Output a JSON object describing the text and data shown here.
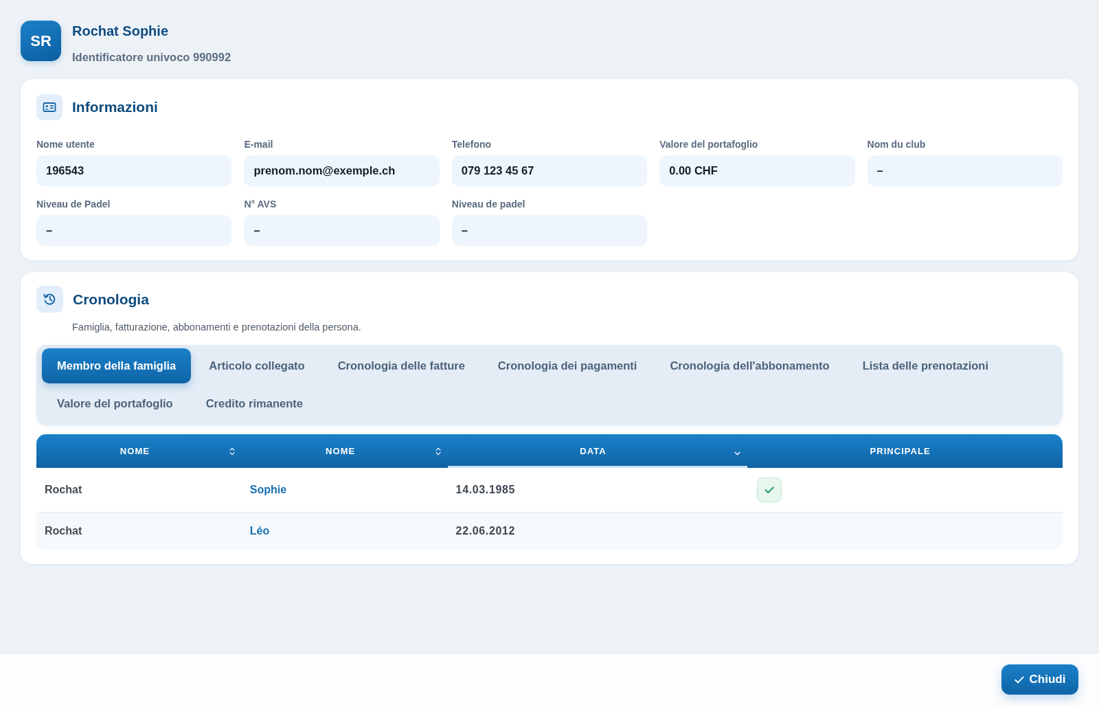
{
  "profile": {
    "initials": "SR",
    "name": "Rochat Sophie",
    "identifier": "Identificatore univoco 990992"
  },
  "info_card": {
    "title": "Informazioni",
    "fields": [
      {
        "label": "Nome utente",
        "value": "196543"
      },
      {
        "label": "E-mail",
        "value": "prenom.nom@exemple.ch"
      },
      {
        "label": "Telefono",
        "value": "079 123 45 67"
      },
      {
        "label": "Valore del portafoglio",
        "value": "0.00 CHF"
      },
      {
        "label": "Nom du club",
        "value": "–"
      },
      {
        "label": "Niveau de Padel",
        "value": "–"
      },
      {
        "label": "N° AVS",
        "value": "–"
      },
      {
        "label": "Niveau de padel",
        "value": "–"
      }
    ]
  },
  "history_card": {
    "title": "Cronologia",
    "subtitle": "Famiglia, fatturazione, abbonamenti e prenotazioni della persona.",
    "tabs": [
      {
        "label": "Membro della famiglia",
        "selected": true
      },
      {
        "label": "Articolo collegato",
        "selected": false
      },
      {
        "label": "Cronologia delle fatture",
        "selected": false
      },
      {
        "label": "Cronologia dei pagamenti",
        "selected": false
      },
      {
        "label": "Cronologia dell'abbonamento",
        "selected": false
      },
      {
        "label": "Lista delle prenotazioni",
        "selected": false
      },
      {
        "label": "Valore del portafoglio",
        "selected": false
      },
      {
        "label": "Credito rimanente",
        "selected": false
      }
    ],
    "table": {
      "columns": [
        {
          "label": "NOME",
          "sortable": true,
          "sorted": false
        },
        {
          "label": "NOME",
          "sortable": true,
          "sorted": false
        },
        {
          "label": "DATA",
          "sortable": true,
          "sorted": true
        },
        {
          "label": "PRINCIPALE",
          "sortable": false,
          "sorted": false
        }
      ],
      "rows": [
        {
          "cells": [
            "Rochat",
            "Sophie",
            "14.03.1985"
          ],
          "principal": true
        },
        {
          "cells": [
            "Rochat",
            "Léo",
            "22.06.2012"
          ],
          "principal": false
        }
      ]
    }
  },
  "footer": {
    "buttons": [
      {
        "label": "Chiudi"
      }
    ]
  }
}
